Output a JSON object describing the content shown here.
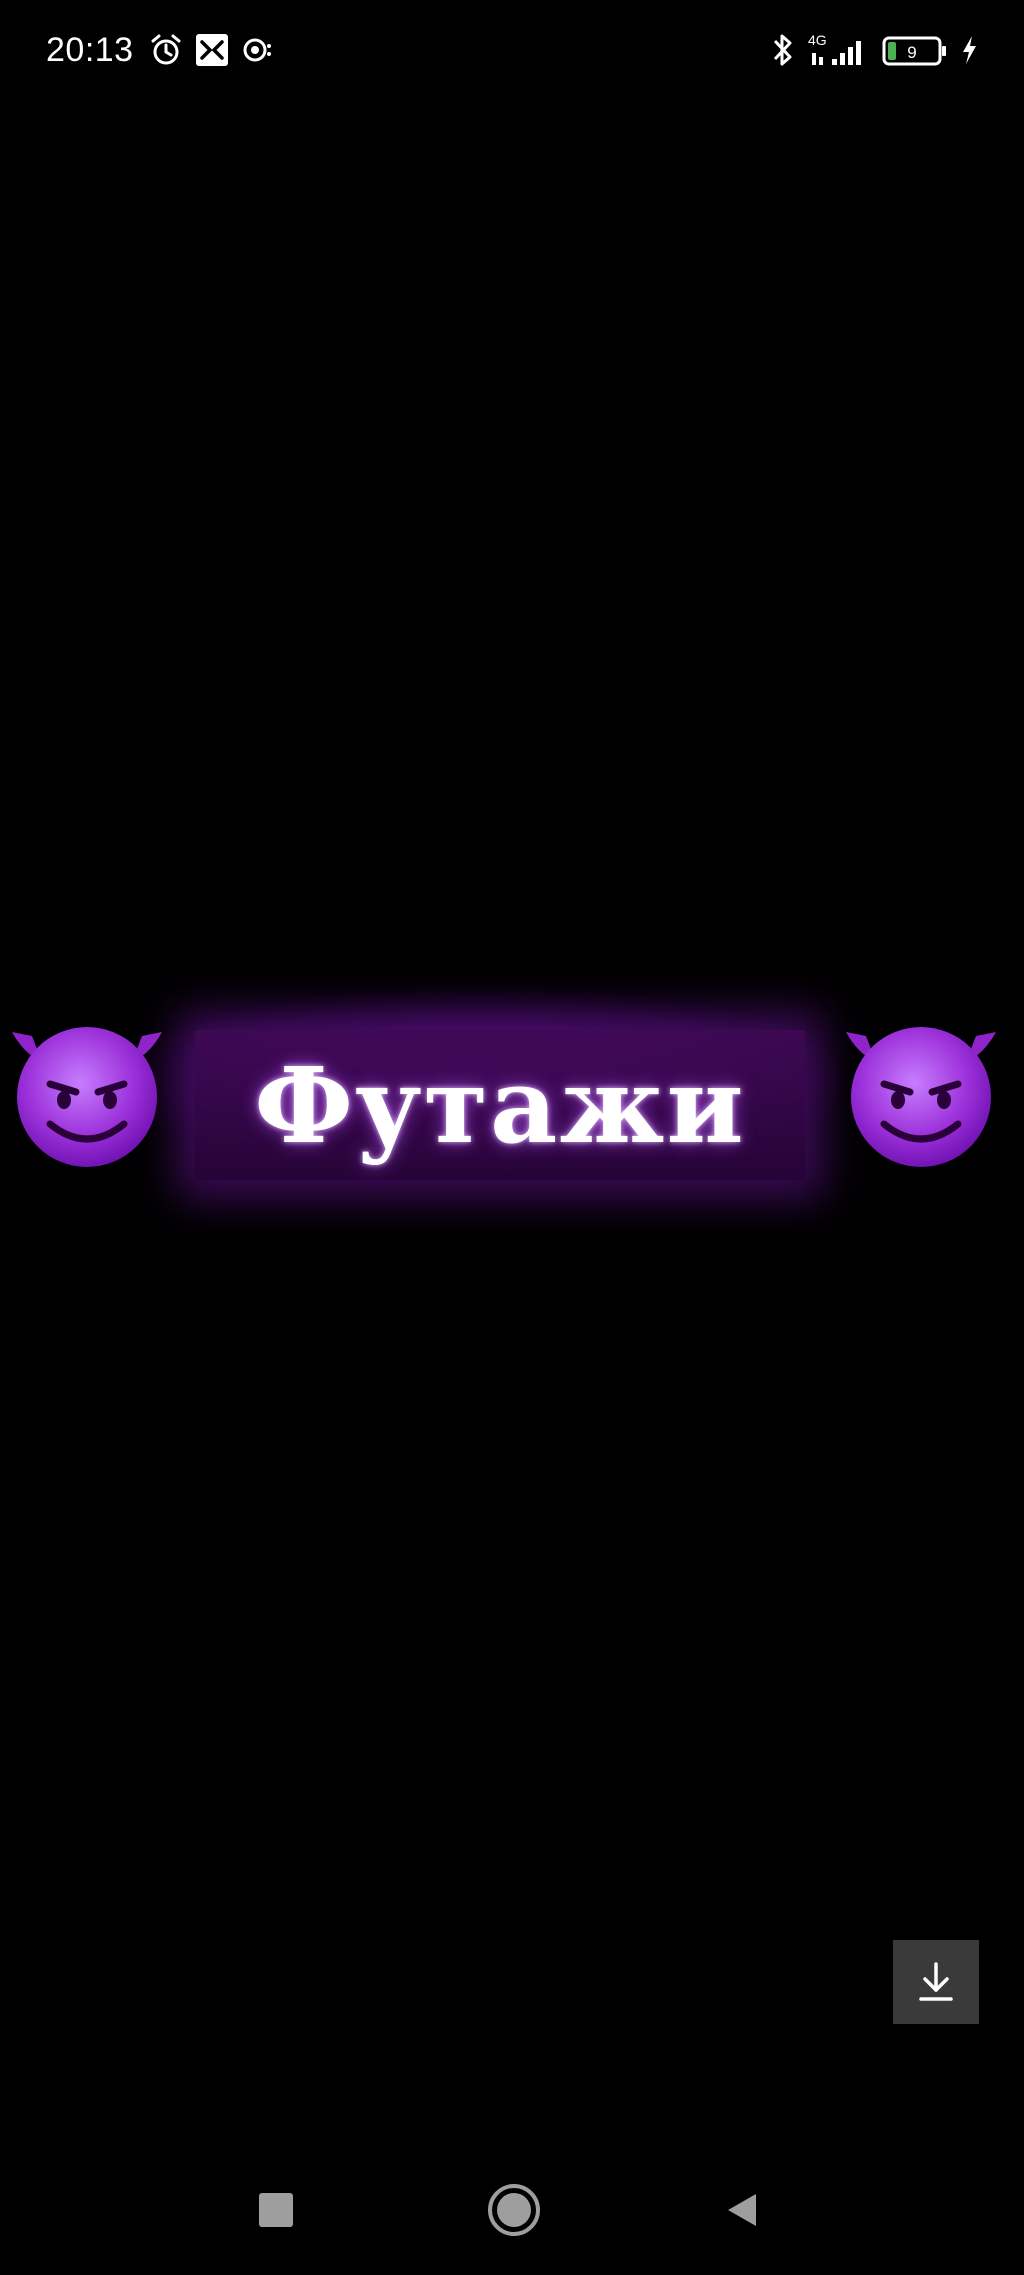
{
  "status_bar": {
    "time": "20:13",
    "left_icons": [
      "alarm-icon",
      "app-notification-icon",
      "screen-record-icon"
    ],
    "right_icons": [
      "bluetooth-icon",
      "signal-4g-icon",
      "battery-icon",
      "charging-icon"
    ],
    "network_label": "4G",
    "battery_level": "9"
  },
  "video": {
    "title": "Футажи",
    "glow_color": "#7b1fa2",
    "emoji_left": "smiling-devil-emoji",
    "emoji_right": "smiling-devil-emoji"
  },
  "download_button": {
    "icon": "download-icon"
  },
  "nav_bar": {
    "buttons": [
      "recent-apps-icon",
      "home-icon",
      "back-icon"
    ]
  }
}
